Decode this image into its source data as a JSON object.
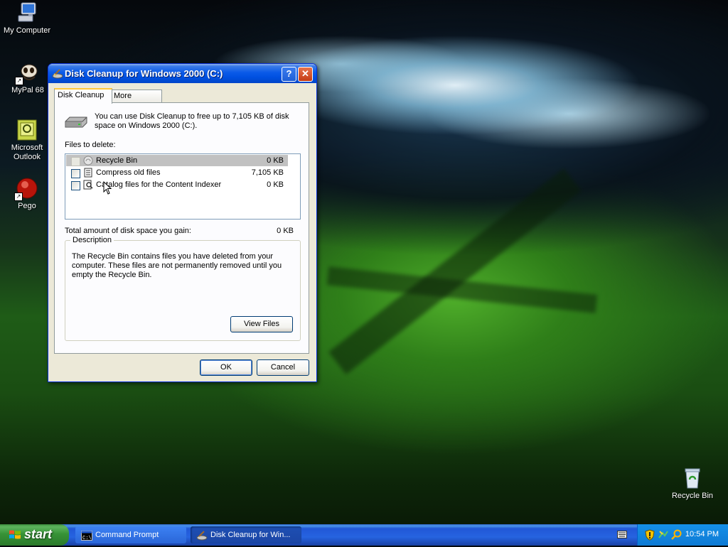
{
  "desktop": {
    "icons": [
      {
        "label": "My Computer"
      },
      {
        "label": "MyPal 68"
      },
      {
        "label": "Microsoft Outlook"
      },
      {
        "label": "Pego"
      },
      {
        "label": "Recycle Bin"
      }
    ]
  },
  "dialog": {
    "title": "Disk Cleanup for Windows 2000 (C:)",
    "help_btn": "?",
    "close_btn": "✕",
    "tabs": [
      {
        "label": "Disk Cleanup",
        "active": true
      },
      {
        "label": "More Options",
        "active": false
      }
    ],
    "intro": "You can use Disk Cleanup to free up to 7,105 KB of disk space on Windows 2000 (C:).",
    "files_label": "Files to delete:",
    "files": [
      {
        "name": "Recycle Bin",
        "size": "0 KB",
        "checked": false,
        "selected": true,
        "icon": "recycle-bin-icon"
      },
      {
        "name": "Compress old files",
        "size": "7,105 KB",
        "checked": false,
        "selected": false,
        "icon": "compress-icon"
      },
      {
        "name": "Catalog files for the Content Indexer",
        "size": "0 KB",
        "checked": false,
        "selected": false,
        "icon": "catalog-icon"
      }
    ],
    "total_label": "Total amount of disk space you gain:",
    "total_value": "0 KB",
    "description_legend": "Description",
    "description_text": "The Recycle Bin contains files you have deleted from your computer. These files are not permanently removed until you empty the Recycle Bin.",
    "view_files_label": "View Files",
    "ok_label": "OK",
    "cancel_label": "Cancel"
  },
  "taskbar": {
    "start_label": "start",
    "tasks": [
      {
        "label": "Command Prompt",
        "active": false
      },
      {
        "label": "Disk Cleanup for Win...",
        "active": true
      }
    ],
    "clock": "10:54 PM"
  },
  "colors": {
    "titlebar": "#0a5ae8",
    "start_green": "#379337",
    "taskbar_blue": "#2663e0",
    "tray_blue": "#0e7ad4"
  }
}
